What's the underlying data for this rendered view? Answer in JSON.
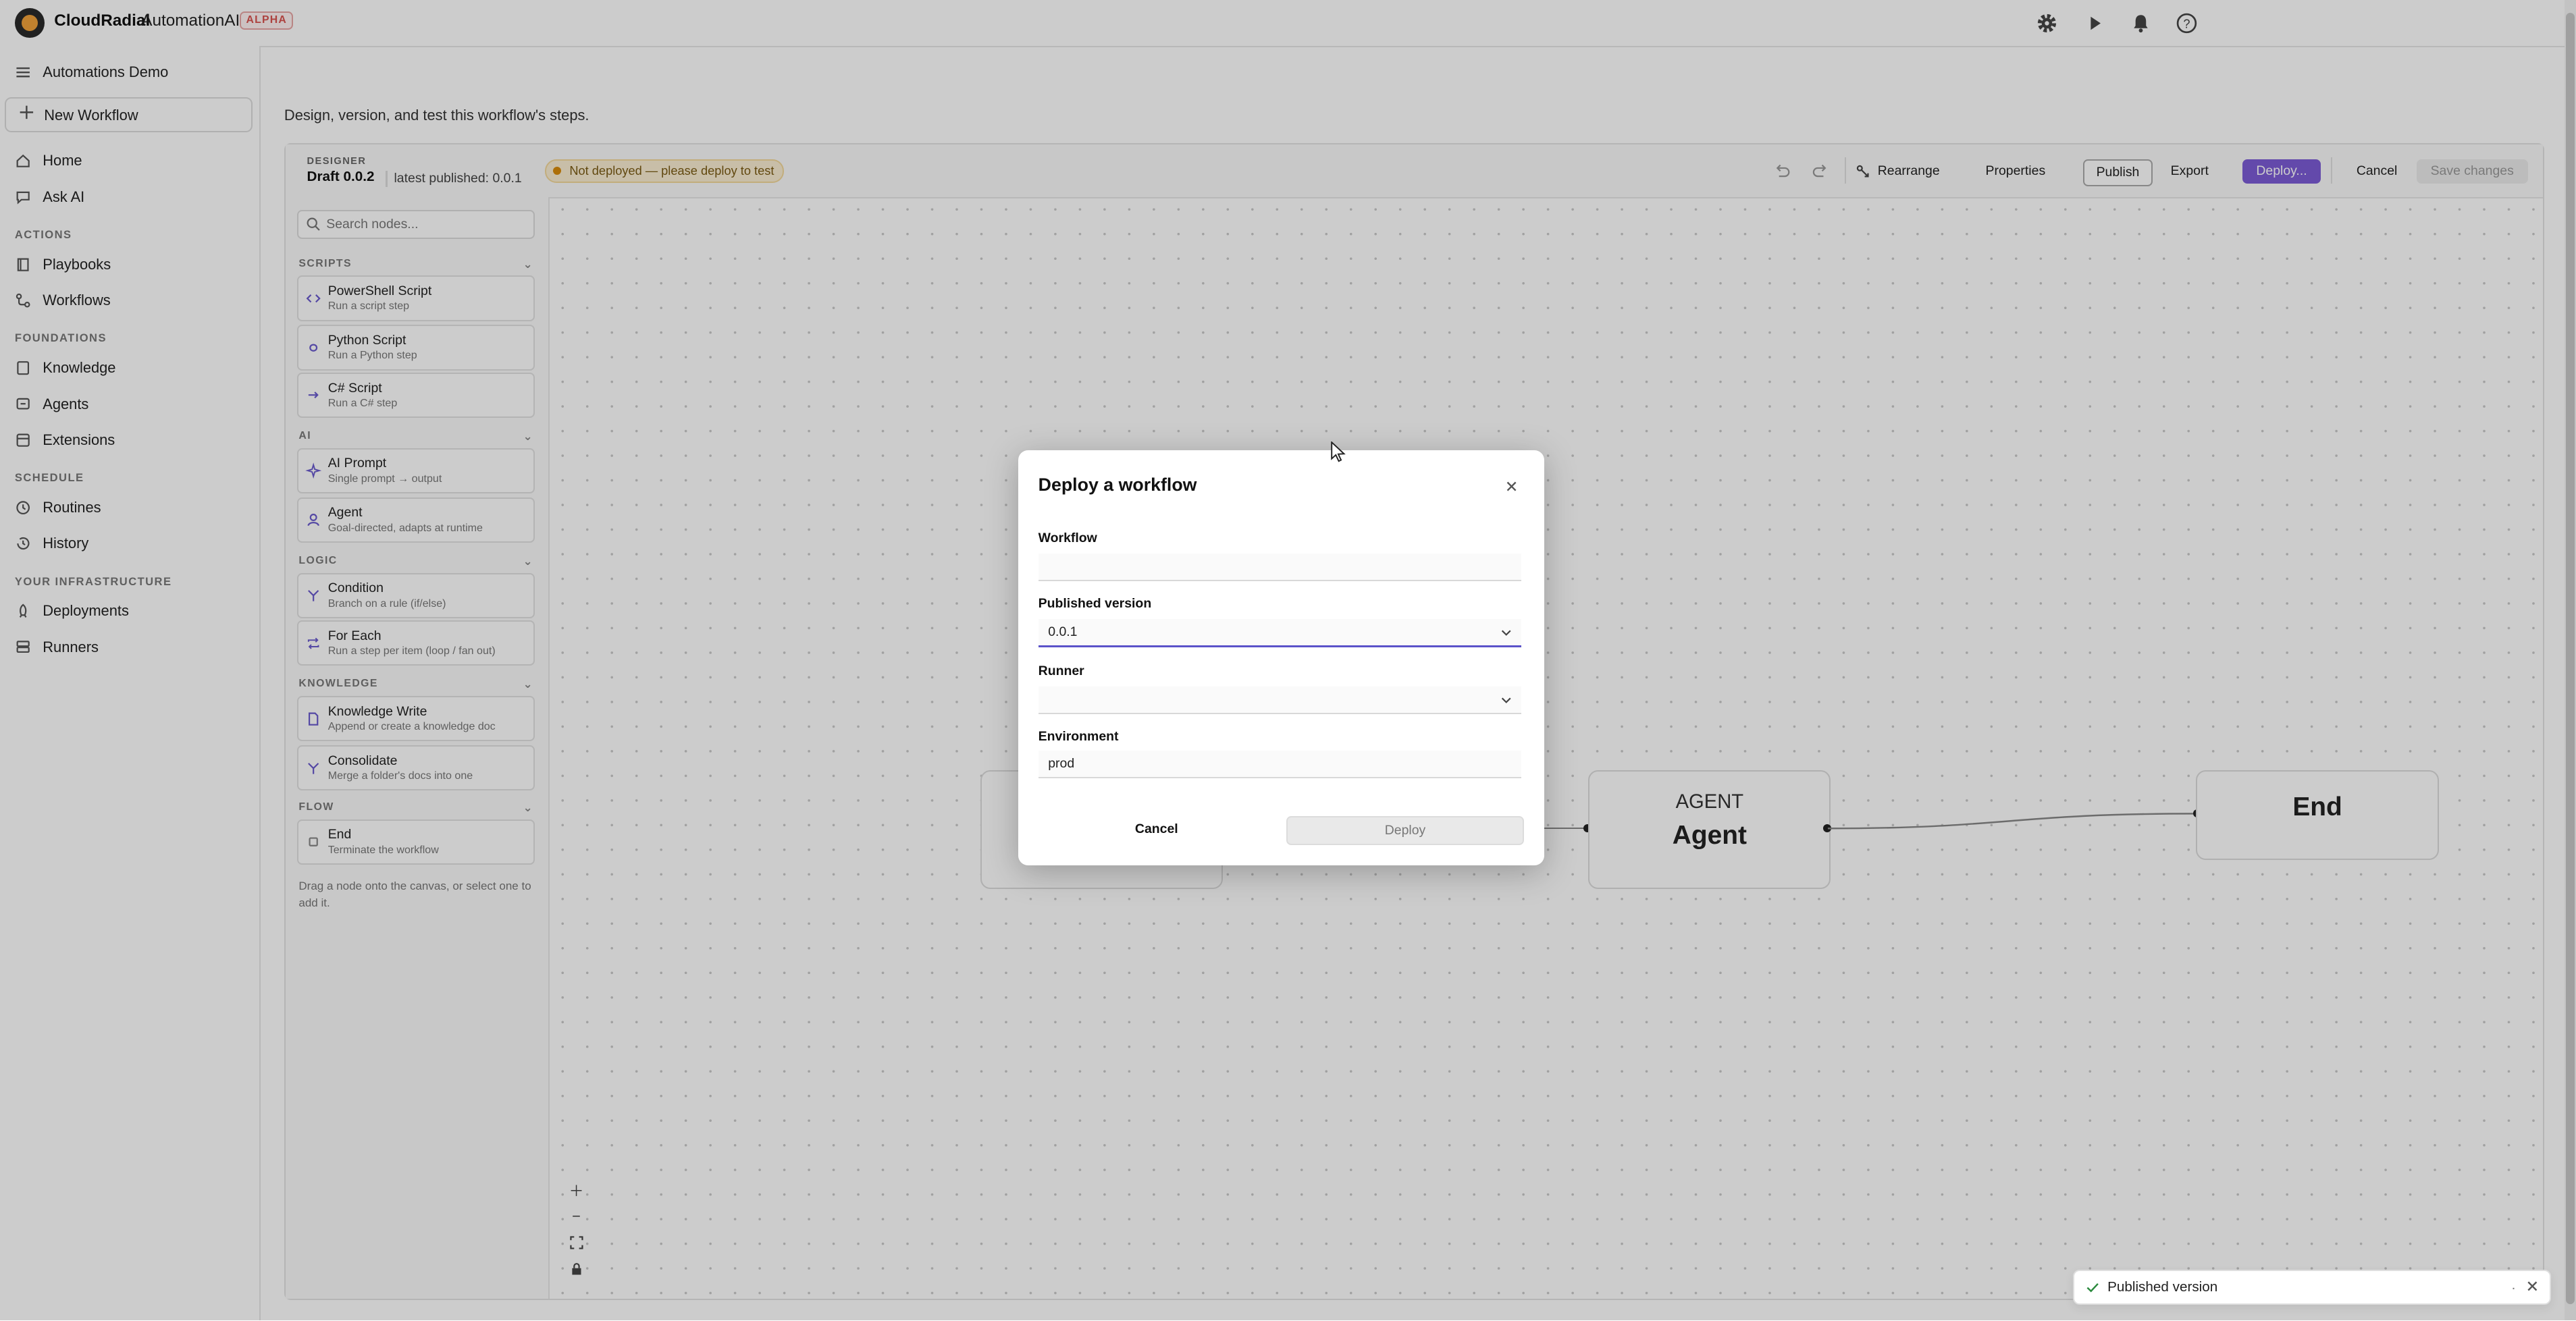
{
  "topbar": {
    "brand": "CloudRadial",
    "product": "AutomationAI",
    "badge": "ALPHA"
  },
  "sidebar": {
    "workspace": "Automations Demo",
    "new_workflow": "New Workflow",
    "items": {
      "home": "Home",
      "ask_ai": "Ask AI",
      "playbooks": "Playbooks",
      "workflows": "Workflows",
      "knowledge": "Knowledge",
      "agents": "Agents",
      "extensions": "Extensions",
      "routines": "Routines",
      "history": "History",
      "deployments": "Deployments",
      "runners": "Runners"
    },
    "sections": {
      "actions": "ACTIONS",
      "foundations": "FOUNDATIONS",
      "schedule": "SCHEDULE",
      "infrastructure": "YOUR INFRASTRUCTURE"
    }
  },
  "main": {
    "subtitle": "Design, version, and test this workflow's steps."
  },
  "designer": {
    "label": "DESIGNER",
    "draft": "Draft 0.0.2",
    "latest": "latest published: 0.0.1",
    "status": "Not deployed — please deploy to test",
    "buttons": {
      "rearrange": "Rearrange",
      "properties": "Properties",
      "publish": "Publish",
      "export": "Export",
      "deploy": "Deploy...",
      "cancel": "Cancel",
      "save": "Save changes"
    }
  },
  "palette": {
    "search_placeholder": "Search nodes...",
    "sections": {
      "scripts": "SCRIPTS",
      "ai": "AI",
      "logic": "LOGIC",
      "knowledge": "KNOWLEDGE",
      "flow": "FLOW"
    },
    "nodes": {
      "powershell": {
        "title": "PowerShell Script",
        "desc": "Run a script step"
      },
      "python": {
        "title": "Python Script",
        "desc": "Run a Python step"
      },
      "csharp": {
        "title": "C# Script",
        "desc": "Run a C# step"
      },
      "ai_prompt": {
        "title": "AI Prompt",
        "desc": "Single prompt → output"
      },
      "agent": {
        "title": "Agent",
        "desc": "Goal-directed, adapts at runtime"
      },
      "condition": {
        "title": "Condition",
        "desc": "Branch on a rule (if/else)"
      },
      "for_each": {
        "title": "For Each",
        "desc": "Run a step per item (loop / fan out)"
      },
      "knowledge_write": {
        "title": "Knowledge Write",
        "desc": "Append or create a knowledge doc"
      },
      "consolidate": {
        "title": "Consolidate",
        "desc": "Merge a folder's docs into one"
      },
      "end": {
        "title": "End",
        "desc": "Terminate the workflow"
      }
    },
    "hint": "Drag a node onto the canvas, or select one to add it."
  },
  "canvas": {
    "agent_node": {
      "kind": "AGENT",
      "title": "Agent"
    },
    "end_node": {
      "title": "End"
    }
  },
  "modal": {
    "title": "Deploy a workflow",
    "workflow_label": "Workflow",
    "workflow_value": "",
    "version_label": "Published version",
    "version_value": "0.0.1",
    "runner_label": "Runner",
    "runner_value": "",
    "env_label": "Environment",
    "env_value": "prod",
    "cancel": "Cancel",
    "deploy": "Deploy"
  },
  "toast": {
    "message": "Published version",
    "extra": "."
  },
  "colors": {
    "accent": "#7c5cd6",
    "status_bg": "#fbeed2",
    "status_dot": "#d98b0b",
    "focus_border": "#5b53c9"
  }
}
